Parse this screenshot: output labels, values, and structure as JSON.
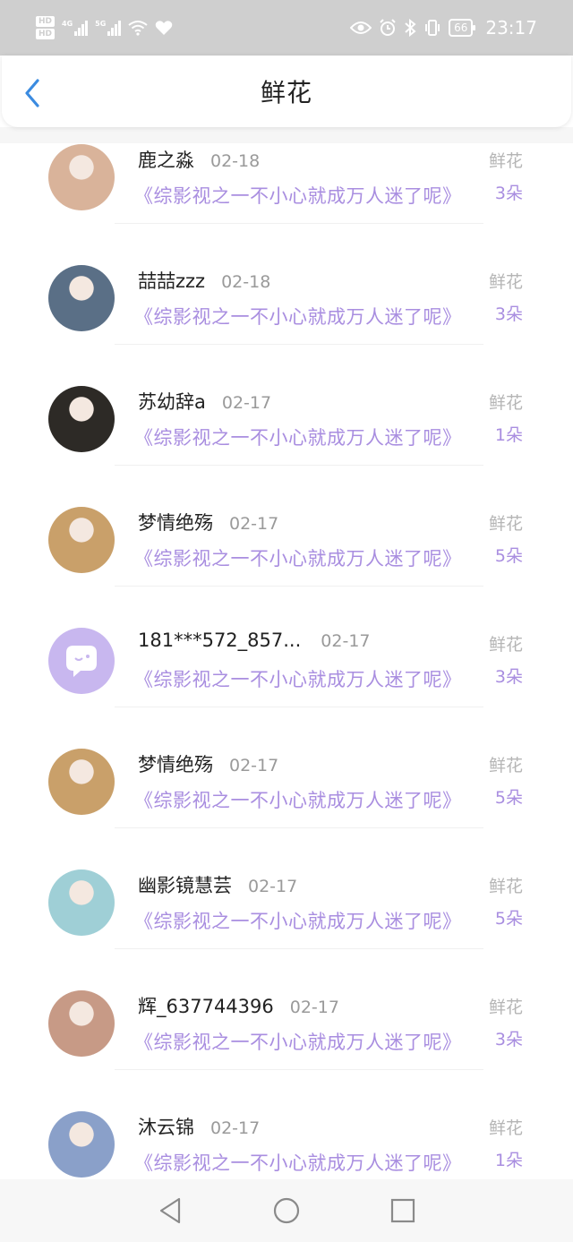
{
  "status_bar": {
    "hd1": "HD",
    "hd2": "HD",
    "net1": "4G",
    "net2": "5G",
    "battery": "66",
    "time": "23:17"
  },
  "header": {
    "title": "鲜花",
    "back_icon": "chevron-left-icon",
    "accent": "#3b8be0"
  },
  "items": [
    {
      "name": "鹿之淼",
      "date": "02-18",
      "book": "《综影视之一不小心就成万人迷了呢》",
      "gift": "鲜花",
      "count": "3朵",
      "avatar_color": "#d9b39a"
    },
    {
      "name": "喆喆zzz",
      "date": "02-18",
      "book": "《综影视之一不小心就成万人迷了呢》",
      "gift": "鲜花",
      "count": "3朵",
      "avatar_color": "#5a6f86"
    },
    {
      "name": "苏幼辞a",
      "date": "02-17",
      "book": "《综影视之一不小心就成万人迷了呢》",
      "gift": "鲜花",
      "count": "1朵",
      "avatar_color": "#2d2a26"
    },
    {
      "name": "梦情绝殇",
      "date": "02-17",
      "book": "《综影视之一不小心就成万人迷了呢》",
      "gift": "鲜花",
      "count": "5朵",
      "avatar_color": "#c9a06a"
    },
    {
      "name": "181***572_857...",
      "date": "02-17",
      "book": "《综影视之一不小心就成万人迷了呢》",
      "gift": "鲜花",
      "count": "3朵",
      "avatar_color": "#c8b7ef"
    },
    {
      "name": "梦情绝殇",
      "date": "02-17",
      "book": "《综影视之一不小心就成万人迷了呢》",
      "gift": "鲜花",
      "count": "5朵",
      "avatar_color": "#c9a06a"
    },
    {
      "name": "幽影镜慧芸",
      "date": "02-17",
      "book": "《综影视之一不小心就成万人迷了呢》",
      "gift": "鲜花",
      "count": "5朵",
      "avatar_color": "#9fcfd6"
    },
    {
      "name": "辉_637744396",
      "date": "02-17",
      "book": "《综影视之一不小心就成万人迷了呢》",
      "gift": "鲜花",
      "count": "3朵",
      "avatar_color": "#c79a86"
    },
    {
      "name": "沐云锦",
      "date": "02-17",
      "book": "《综影视之一不小心就成万人迷了呢》",
      "gift": "鲜花",
      "count": "1朵",
      "avatar_color": "#8aa0c9"
    }
  ],
  "nav": {
    "back_icon": "triangle-back-icon",
    "home_icon": "circle-home-icon",
    "recents_icon": "square-recents-icon"
  }
}
